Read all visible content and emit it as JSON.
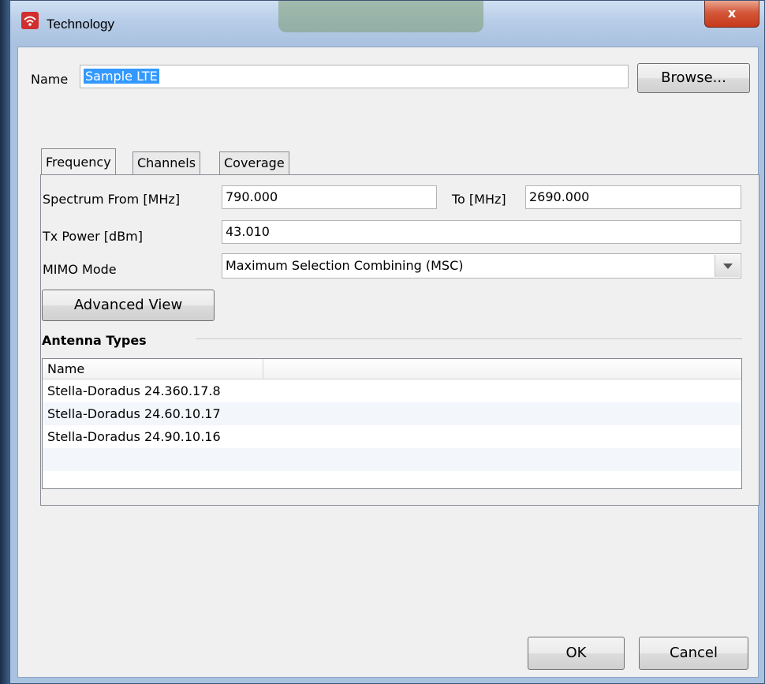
{
  "window": {
    "title": "Technology",
    "close_label": "x",
    "icon": "wifi-icon",
    "accent_color": "#d12e2e"
  },
  "name_row": {
    "label": "Name",
    "value": "Sample LTE",
    "browse_label": "Browse..."
  },
  "tabs": [
    {
      "label": "Frequency",
      "active": true
    },
    {
      "label": "Channels",
      "active": false
    },
    {
      "label": "Coverage",
      "active": false
    }
  ],
  "frequency": {
    "spectrum_from_label": "Spectrum From [MHz]",
    "spectrum_from_value": "790.000",
    "to_label": "To [MHz]",
    "to_value": "2690.000",
    "tx_power_label": "Tx Power [dBm]",
    "tx_power_value": "43.010",
    "mimo_label": "MIMO Mode",
    "mimo_value": "Maximum Selection Combining (MSC)",
    "advanced_view_label": "Advanced View"
  },
  "antenna_types": {
    "heading": "Antenna Types",
    "column_name": "Name",
    "rows": [
      "Stella-Doradus 24.360.17.8",
      "Stella-Doradus 24.60.10.17",
      "Stella-Doradus 24.90.10.16"
    ]
  },
  "footer": {
    "ok_label": "OK",
    "cancel_label": "Cancel"
  }
}
